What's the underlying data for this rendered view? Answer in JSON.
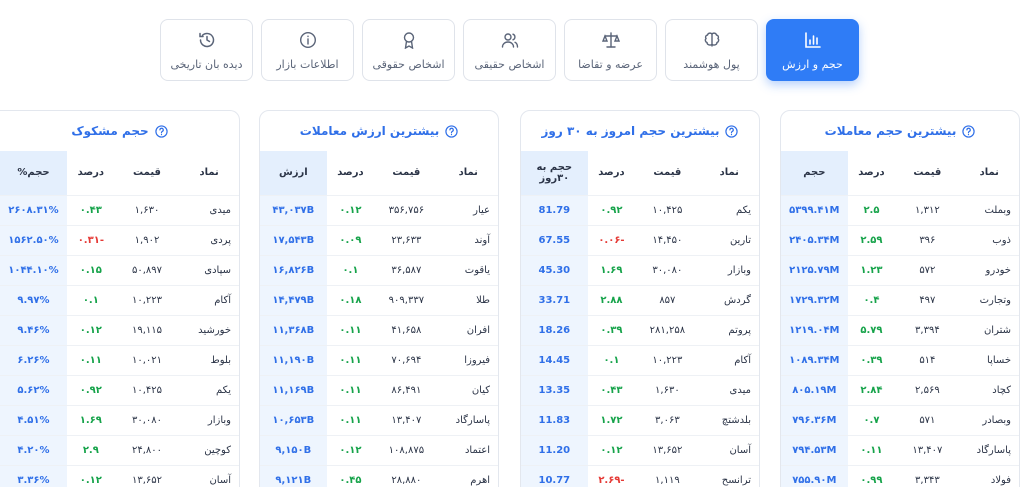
{
  "tabs": [
    {
      "name": "volume-value",
      "label": "حجم و ارزش",
      "icon": "bar-chart-icon",
      "active": true
    },
    {
      "name": "smart-money",
      "label": "پول هوشمند",
      "icon": "brain-icon",
      "active": false
    },
    {
      "name": "supply-demand",
      "label": "عرضه و تقاضا",
      "icon": "scale-icon",
      "active": false
    },
    {
      "name": "individuals",
      "label": "اشخاص حقیقی",
      "icon": "users-icon",
      "active": false
    },
    {
      "name": "institutions",
      "label": "اشخاص حقوقی",
      "icon": "award-icon",
      "active": false
    },
    {
      "name": "market-info",
      "label": "اطلاعات بازار",
      "icon": "info-icon",
      "active": false
    },
    {
      "name": "history-watch",
      "label": "دیده بان تاریخی",
      "icon": "history-icon",
      "active": false
    }
  ],
  "cards": [
    {
      "title": "بیشترین حجم معاملات",
      "headers": {
        "symbol": "نماد",
        "price": "قیمت",
        "percent": "درصد",
        "volume": "حجم"
      },
      "rows": [
        {
          "symbol": "وبملت",
          "price": "۱,۳۱۲",
          "percent": "۲.۵",
          "sign": "pos",
          "volume": "۵۳۹۹.۴۱M"
        },
        {
          "symbol": "ذوب",
          "price": "۳۹۶",
          "percent": "۲.۵۹",
          "sign": "pos",
          "volume": "۲۴۰۵.۳۴M"
        },
        {
          "symbol": "خودرو",
          "price": "۵۷۲",
          "percent": "۱.۲۳",
          "sign": "pos",
          "volume": "۲۱۲۵.۷۹M"
        },
        {
          "symbol": "وتجارت",
          "price": "۴۹۷",
          "percent": "۰.۴",
          "sign": "pos",
          "volume": "۱۷۲۹.۳۲M"
        },
        {
          "symbol": "شتران",
          "price": "۳,۳۹۴",
          "percent": "۵.۷۹",
          "sign": "pos",
          "volume": "۱۲۱۹.۰۴M"
        },
        {
          "symbol": "خساپا",
          "price": "۵۱۴",
          "percent": "۰.۳۹",
          "sign": "pos",
          "volume": "۱۰۸۹.۳۴M"
        },
        {
          "symbol": "کچاد",
          "price": "۲,۵۶۹",
          "percent": "۲.۸۴",
          "sign": "pos",
          "volume": "۸۰۵.۱۹M"
        },
        {
          "symbol": "وبصادر",
          "price": "۵۷۱",
          "percent": "۰.۷",
          "sign": "pos",
          "volume": "۷۹۶.۳۶M"
        },
        {
          "symbol": "پاسارگاد",
          "price": "۱۳,۴۰۷",
          "percent": "۰.۱۱",
          "sign": "pos",
          "volume": "۷۹۴.۵۳M"
        },
        {
          "symbol": "فولاد",
          "price": "۳,۳۴۳",
          "percent": "۰.۹۹",
          "sign": "pos",
          "volume": "۷۵۵.۹۰M"
        }
      ]
    },
    {
      "title": "بیشترین حجم امروز به ۳۰ روز",
      "headers": {
        "symbol": "نماد",
        "price": "قیمت",
        "percent": "درصد",
        "volume": "حجم به ۳۰روز"
      },
      "rows": [
        {
          "symbol": "یکم",
          "price": "۱۰,۴۲۵",
          "percent": "۰.۹۲",
          "sign": "pos",
          "volume": "81.79"
        },
        {
          "symbol": "تارین",
          "price": "۱۴,۴۵۰",
          "percent": "-۰.۰۶",
          "sign": "neg",
          "volume": "67.55"
        },
        {
          "symbol": "وبازار",
          "price": "۳۰,۰۸۰",
          "percent": "۱.۶۹",
          "sign": "pos",
          "volume": "45.30"
        },
        {
          "symbol": "گردش",
          "price": "۸۵۷",
          "percent": "۲.۸۸",
          "sign": "pos",
          "volume": "33.71"
        },
        {
          "symbol": "پروتم",
          "price": "۲۸۱,۲۵۸",
          "percent": "۰.۳۹",
          "sign": "pos",
          "volume": "18.26"
        },
        {
          "symbol": "آکام",
          "price": "۱۰,۲۲۳",
          "percent": "۰.۱",
          "sign": "pos",
          "volume": "14.45"
        },
        {
          "symbol": "میدی",
          "price": "۱,۶۳۰",
          "percent": "۰.۴۳",
          "sign": "pos",
          "volume": "13.35"
        },
        {
          "symbol": "بلدشتچ",
          "price": "۳,۰۶۳",
          "percent": "۱.۷۲",
          "sign": "pos",
          "volume": "11.83"
        },
        {
          "symbol": "آسان",
          "price": "۱۳,۶۵۲",
          "percent": "۰.۱۲",
          "sign": "pos",
          "volume": "11.20"
        },
        {
          "symbol": "ترانسح",
          "price": "۱,۱۱۹",
          "percent": "-۲.۶۹",
          "sign": "neg",
          "volume": "10.77"
        }
      ]
    },
    {
      "title": "بیشترین ارزش معاملات",
      "headers": {
        "symbol": "نماد",
        "price": "قیمت",
        "percent": "درصد",
        "volume": "ارزش"
      },
      "rows": [
        {
          "symbol": "عیار",
          "price": "۳۵۶,۷۵۶",
          "percent": "۰.۱۲",
          "sign": "pos",
          "volume": "۴۳,۰۳۷B"
        },
        {
          "symbol": "آوند",
          "price": "۲۳,۶۳۳",
          "percent": "۰.۰۹",
          "sign": "pos",
          "volume": "۱۷,۵۴۳B"
        },
        {
          "symbol": "یاقوت",
          "price": "۳۶,۵۸۷",
          "percent": "۰.۱",
          "sign": "pos",
          "volume": "۱۶,۸۲۶B"
        },
        {
          "symbol": "طلا",
          "price": "۹۰۹,۳۳۷",
          "percent": "۰.۱۸",
          "sign": "pos",
          "volume": "۱۴,۴۷۹B"
        },
        {
          "symbol": "افران",
          "price": "۴۱,۶۵۸",
          "percent": "۰.۱۱",
          "sign": "pos",
          "volume": "۱۱,۳۶۸B"
        },
        {
          "symbol": "فیروزا",
          "price": "۷۰,۶۹۴",
          "percent": "۰.۱۱",
          "sign": "pos",
          "volume": "۱۱,۱۹۰B"
        },
        {
          "symbol": "کیان",
          "price": "۸۶,۴۹۱",
          "percent": "۰.۱۱",
          "sign": "pos",
          "volume": "۱۱,۱۶۹B"
        },
        {
          "symbol": "پاسارگاد",
          "price": "۱۳,۴۰۷",
          "percent": "۰.۱۱",
          "sign": "pos",
          "volume": "۱۰,۶۵۳B"
        },
        {
          "symbol": "اعتماد",
          "price": "۱۰۸,۸۷۵",
          "percent": "۰.۱۲",
          "sign": "pos",
          "volume": "۹,۱۵۰B"
        },
        {
          "symbol": "اهرم",
          "price": "۲۸,۸۸۰",
          "percent": "۰.۴۵",
          "sign": "pos",
          "volume": "۹,۱۲۱B"
        }
      ]
    },
    {
      "title": "حجم مشکوک",
      "headers": {
        "symbol": "نماد",
        "price": "قیمت",
        "percent": "درصد",
        "volume": "حجم%"
      },
      "rows": [
        {
          "symbol": "میدی",
          "price": "۱,۶۳۰",
          "percent": "۰.۴۳",
          "sign": "pos",
          "volume": "۲۶۰۸.۳۱%"
        },
        {
          "symbol": "پردی",
          "price": "۱,۹۰۲",
          "percent": "-۰.۳۱",
          "sign": "neg",
          "volume": "۱۵۶۲.۵۰%"
        },
        {
          "symbol": "سپادی",
          "price": "۵۰,۸۹۷",
          "percent": "۰.۱۵",
          "sign": "pos",
          "volume": "۱۰۴۴.۱۰%"
        },
        {
          "symbol": "آکام",
          "price": "۱۰,۲۲۳",
          "percent": "۰.۱",
          "sign": "pos",
          "volume": "۹.۹۷%"
        },
        {
          "symbol": "خورشید",
          "price": "۱۹,۱۱۵",
          "percent": "۰.۱۲",
          "sign": "pos",
          "volume": "۹.۴۶%"
        },
        {
          "symbol": "بلوط",
          "price": "۱۰,۰۲۱",
          "percent": "۰.۱۱",
          "sign": "pos",
          "volume": "۶.۲۶%"
        },
        {
          "symbol": "یکم",
          "price": "۱۰,۴۲۵",
          "percent": "۰.۹۲",
          "sign": "pos",
          "volume": "۵.۶۲%"
        },
        {
          "symbol": "وبازار",
          "price": "۳۰,۰۸۰",
          "percent": "۱.۶۹",
          "sign": "pos",
          "volume": "۴.۵۱%"
        },
        {
          "symbol": "کوچین",
          "price": "۲۴,۸۰۰",
          "percent": "۲.۹",
          "sign": "pos",
          "volume": "۴.۲۰%"
        },
        {
          "symbol": "آسان",
          "price": "۱۳,۶۵۲",
          "percent": "۰.۱۲",
          "sign": "pos",
          "volume": "۳.۳۶%"
        }
      ]
    }
  ],
  "colors": {
    "accent": "#2f7cf6",
    "positive": "#16a34a",
    "negative": "#e53935",
    "highlight": "#e4effd"
  }
}
